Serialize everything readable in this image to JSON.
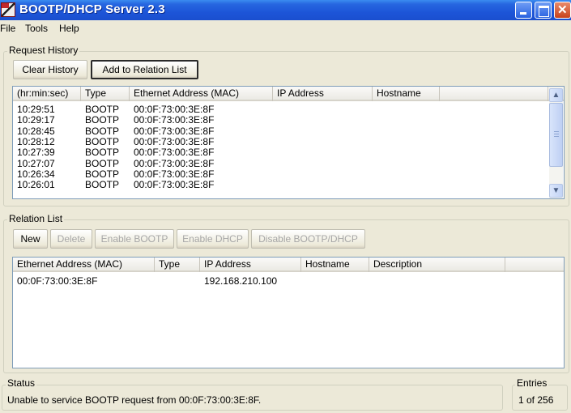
{
  "window": {
    "title": "BOOTP/DHCP Server 2.3",
    "icon": "app-icon",
    "controls": [
      "minimize-icon",
      "maximize-icon",
      "close-icon"
    ]
  },
  "menubar": {
    "items": [
      "File",
      "Tools",
      "Help"
    ]
  },
  "request_history": {
    "label": "Request History",
    "buttons": {
      "clear": "Clear History",
      "add": "Add to Relation List"
    },
    "columns": [
      "(hr:min:sec)",
      "Type",
      "Ethernet Address (MAC)",
      "IP Address",
      "Hostname",
      ""
    ],
    "rows": [
      {
        "time": "10:29:51",
        "type": "BOOTP",
        "mac": "00:0F:73:00:3E:8F",
        "ip": "",
        "hostname": ""
      },
      {
        "time": "10:29:17",
        "type": "BOOTP",
        "mac": "00:0F:73:00:3E:8F",
        "ip": "",
        "hostname": ""
      },
      {
        "time": "10:28:45",
        "type": "BOOTP",
        "mac": "00:0F:73:00:3E:8F",
        "ip": "",
        "hostname": ""
      },
      {
        "time": "10:28:12",
        "type": "BOOTP",
        "mac": "00:0F:73:00:3E:8F",
        "ip": "",
        "hostname": ""
      },
      {
        "time": "10:27:39",
        "type": "BOOTP",
        "mac": "00:0F:73:00:3E:8F",
        "ip": "",
        "hostname": ""
      },
      {
        "time": "10:27:07",
        "type": "BOOTP",
        "mac": "00:0F:73:00:3E:8F",
        "ip": "",
        "hostname": ""
      },
      {
        "time": "10:26:34",
        "type": "BOOTP",
        "mac": "00:0F:73:00:3E:8F",
        "ip": "",
        "hostname": ""
      },
      {
        "time": "10:26:01",
        "type": "BOOTP",
        "mac": "00:0F:73:00:3E:8F",
        "ip": "",
        "hostname": ""
      }
    ],
    "scrollbar": {
      "up": "chevron-up-icon",
      "down": "chevron-down-icon"
    }
  },
  "relation_list": {
    "label": "Relation List",
    "buttons": {
      "new": "New",
      "delete": "Delete",
      "enable_bootp": "Enable BOOTP",
      "enable_dhcp": "Enable DHCP",
      "disable": "Disable BOOTP/DHCP"
    },
    "columns": [
      "Ethernet Address (MAC)",
      "Type",
      "IP Address",
      "Hostname",
      "Description",
      ""
    ],
    "rows": [
      {
        "mac": "00:0F:73:00:3E:8F",
        "type": "",
        "ip": "192.168.210.100",
        "hostname": "",
        "description": ""
      }
    ]
  },
  "status": {
    "label": "Status",
    "text": "Unable to service BOOTP request from 00:0F:73:00:3E:8F."
  },
  "entries": {
    "label": "Entries",
    "text": "1 of 256"
  }
}
